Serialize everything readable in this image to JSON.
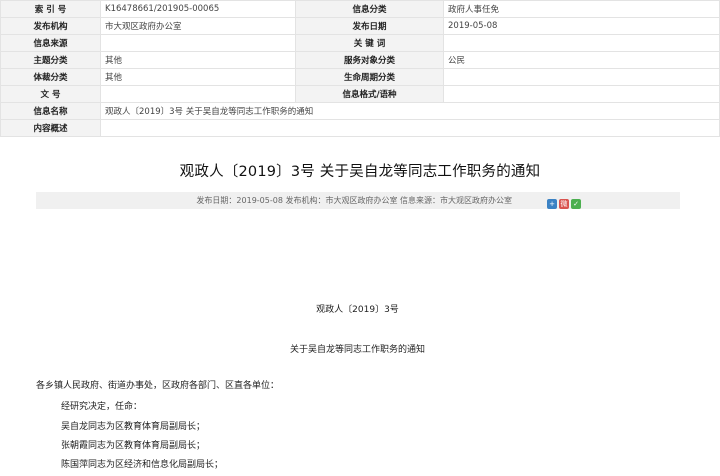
{
  "meta": {
    "rows": [
      [
        {
          "k": "索 引 号",
          "v": "K16478661/201905-00065"
        },
        {
          "k": "信息分类",
          "v": "政府人事任免"
        }
      ],
      [
        {
          "k": "发布机构",
          "v": "市大观区政府办公室"
        },
        {
          "k": "发布日期",
          "v": "2019-05-08"
        }
      ],
      [
        {
          "k": "信息来源",
          "v": ""
        },
        {
          "k": "关 键 词",
          "v": ""
        }
      ],
      [
        {
          "k": "主题分类",
          "v": "其他"
        },
        {
          "k": "服务对象分类",
          "v": "公民"
        }
      ],
      [
        {
          "k": "体裁分类",
          "v": "其他"
        },
        {
          "k": "生命周期分类",
          "v": ""
        }
      ],
      [
        {
          "k": "文 号",
          "v": ""
        },
        {
          "k": "信息格式/语种",
          "v": ""
        }
      ]
    ],
    "name_label": "信息名称",
    "name_value": "观政人〔2019〕3号 关于吴自龙等同志工作职务的通知",
    "summary_label": "内容概述",
    "summary_value": ""
  },
  "article": {
    "title": "观政人〔2019〕3号 关于吴自龙等同志工作职务的通知",
    "info": "发布日期：2019-05-08    发布机构：市大观区政府办公室    信息来源：市大观区政府办公室",
    "share_icons": [
      "share-plus-icon",
      "weibo-icon",
      "wechat-icon"
    ],
    "doc_no": "观政人〔2019〕3号",
    "subtitle": "关于吴自龙等同志工作职务的通知",
    "salutation": "各乡镇人民政府、街道办事处，区政府各部门、区直各单位：",
    "lines": [
      "经研究决定，任命：",
      "吴自龙同志为区教育体育局副局长；",
      "张朝霞同志为区教育体育局副局长；",
      "陈国萍同志为区经济和信息化局副局长；"
    ]
  }
}
